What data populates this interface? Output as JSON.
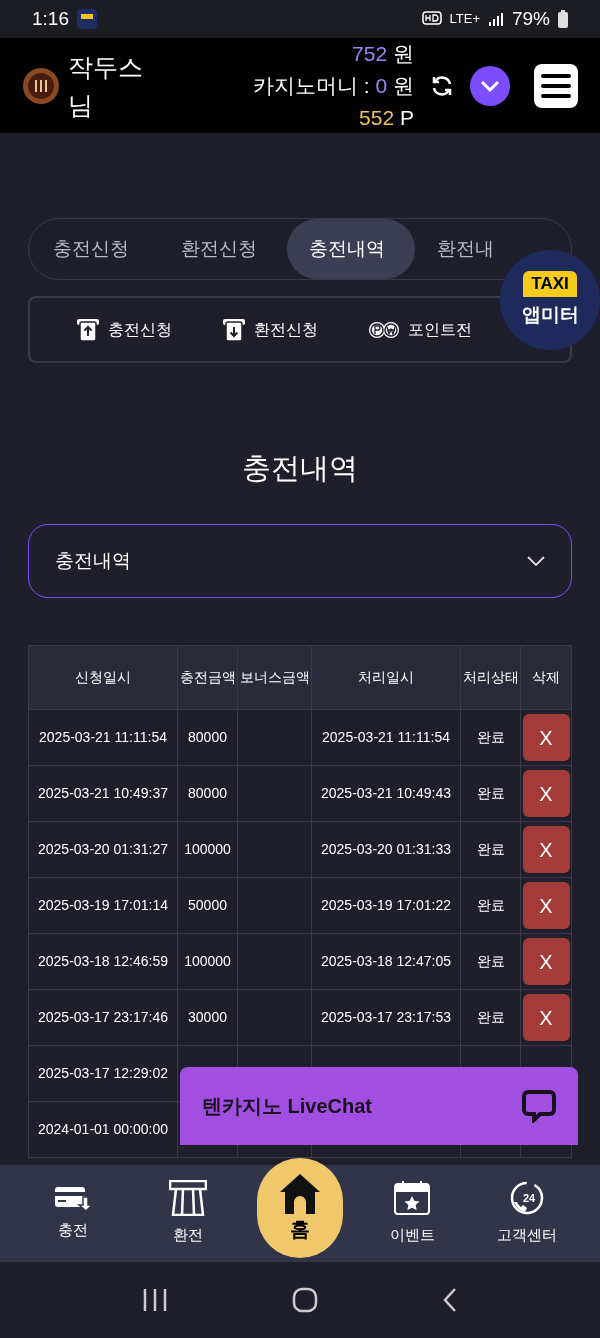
{
  "status_bar": {
    "time": "1:16",
    "network": "LTE+",
    "battery": "79%"
  },
  "header": {
    "username": "작두스\n님",
    "balance": "752",
    "balance_unit": "원",
    "casino_label": "카지노머니 :",
    "casino_money": "0",
    "casino_unit": "원",
    "points": "552",
    "points_unit": "P"
  },
  "tabs": [
    {
      "label": "충전신청",
      "selected": false
    },
    {
      "label": "환전신청",
      "selected": false
    },
    {
      "label": "충전내역",
      "selected": true
    },
    {
      "label": "환전내",
      "selected": false
    }
  ],
  "quick_links": [
    {
      "label": "충전신청",
      "kind": "deposit"
    },
    {
      "label": "환전신청",
      "kind": "withdraw"
    },
    {
      "label": "포인트전",
      "kind": "points"
    }
  ],
  "taxi_badge": {
    "sign": "TAXI",
    "label": "앱미터"
  },
  "page_title": "충전내역",
  "history_select": {
    "value": "충전내역"
  },
  "table": {
    "columns": [
      "신청일시",
      "충전금액",
      "보너스금액",
      "처리일시",
      "처리상태",
      "삭제"
    ],
    "rows": [
      {
        "requested": "2025-03-21 11:11:54",
        "amount": "80000",
        "processed": "2025-03-21 11:11:54",
        "status": "완료",
        "delete": "X"
      },
      {
        "requested": "2025-03-21 10:49:37",
        "amount": "80000",
        "processed": "2025-03-21 10:49:43",
        "status": "완료",
        "delete": "X"
      },
      {
        "requested": "2025-03-20 01:31:27",
        "amount": "100000",
        "processed": "2025-03-20 01:31:33",
        "status": "완료",
        "delete": "X"
      },
      {
        "requested": "2025-03-19 17:01:14",
        "amount": "50000",
        "processed": "2025-03-19 17:01:22",
        "status": "완료",
        "delete": "X"
      },
      {
        "requested": "2025-03-18 12:46:59",
        "amount": "100000",
        "processed": "2025-03-18 12:47:05",
        "status": "완료",
        "delete": "X"
      },
      {
        "requested": "2025-03-17 23:17:46",
        "amount": "30000",
        "processed": "2025-03-17 23:17:53",
        "status": "완료",
        "delete": "X"
      },
      {
        "requested": "2025-03-17 12:29:02"
      },
      {
        "requested": "2024-01-01 00:00:00"
      }
    ]
  },
  "live_chat": {
    "label": "텐카지노 LiveChat"
  },
  "bottom_nav": [
    {
      "label": "충전",
      "kind": "card",
      "selected": false
    },
    {
      "label": "환전",
      "kind": "atm",
      "selected": false
    },
    {
      "label": "홈",
      "kind": "home",
      "selected": true
    },
    {
      "label": "이벤트",
      "kind": "calendar",
      "selected": false
    },
    {
      "label": "고객센터",
      "kind": "support",
      "selected": false,
      "icon_text": "24"
    }
  ]
}
